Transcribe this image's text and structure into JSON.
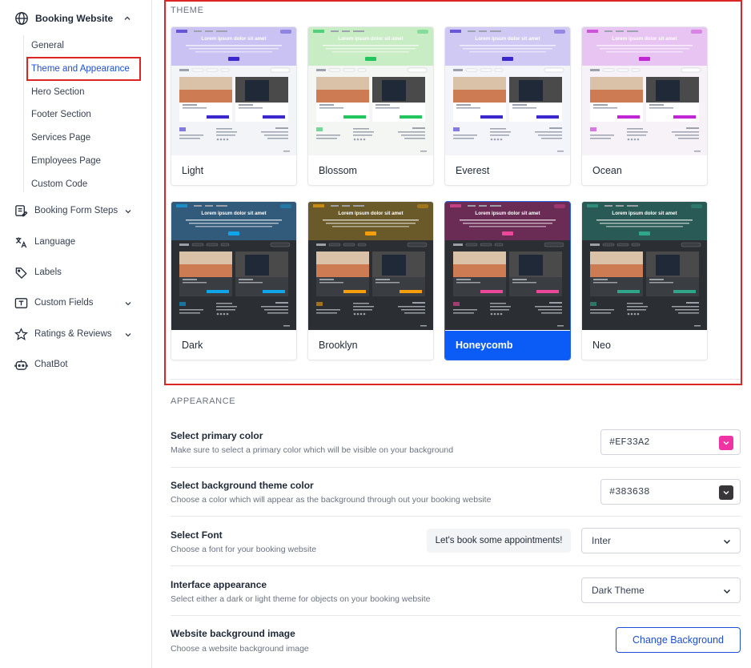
{
  "sidebar": {
    "top": {
      "label": "Booking Website",
      "icon": "globe-icon"
    },
    "subitems": [
      {
        "label": "General"
      },
      {
        "label": "Theme and Appearance",
        "active": true
      },
      {
        "label": "Hero Section"
      },
      {
        "label": "Footer Section"
      },
      {
        "label": "Services Page"
      },
      {
        "label": "Employees Page"
      },
      {
        "label": "Custom Code"
      }
    ],
    "items": [
      {
        "label": "Booking Form Steps",
        "icon": "form-steps-icon"
      },
      {
        "label": "Language",
        "icon": "translate-icon"
      },
      {
        "label": "Labels",
        "icon": "tag-icon"
      },
      {
        "label": "Custom Fields",
        "icon": "text-field-icon"
      },
      {
        "label": "Ratings & Reviews",
        "icon": "star-icon"
      },
      {
        "label": "ChatBot",
        "icon": "bot-icon"
      }
    ]
  },
  "theme": {
    "section_label": "THEME",
    "preview_headline": "Lorem ipsum dolor sit amet",
    "cards": [
      {
        "name": "Light",
        "accent": "#3b28cc",
        "bg": "#f3f4f8",
        "top": "#c9c2f2"
      },
      {
        "name": "Blossom",
        "accent": "#22c55e",
        "bg": "#f3f6f3",
        "top": "#c8ecc4"
      },
      {
        "name": "Everest",
        "accent": "#3b28cc",
        "bg": "#f4f4fb",
        "top": "#cfc9f3"
      },
      {
        "name": "Ocean",
        "accent": "#c026d3",
        "bg": "#f6f2f8",
        "top": "#e7c4f2"
      },
      {
        "name": "Dark",
        "accent": "#0ea5e9",
        "bg": "#2b2e33",
        "top": "#325a7a"
      },
      {
        "name": "Brooklyn",
        "accent": "#f59e0b",
        "bg": "#2b2e33",
        "top": "#6a5a2a"
      },
      {
        "name": "Honeycomb",
        "accent": "#ec4899",
        "bg": "#2b2e33",
        "top": "#6a2b55",
        "selected": true
      },
      {
        "name": "Neo",
        "accent": "#2fa58a",
        "bg": "#2b2e33",
        "top": "#2a5a55"
      }
    ]
  },
  "appearance": {
    "section_label": "APPEARANCE",
    "primary": {
      "title": "Select primary color",
      "subtitle": "Make sure to select a primary color which will be visible on your background",
      "value": "#EF33A2",
      "swatch_color": "#EF33A2"
    },
    "background": {
      "title": "Select background theme color",
      "subtitle": "Choose a color which will appear as the background through out your booking website",
      "value": "#383638",
      "swatch_color": "#383638"
    },
    "font": {
      "title": "Select Font",
      "subtitle": "Choose a font for your booking website",
      "preview": "Let's book some appointments!",
      "value": "Inter"
    },
    "interface": {
      "title": "Interface appearance",
      "subtitle": "Select either a dark or light theme for objects on your booking website",
      "value": "Dark Theme"
    },
    "bg_image": {
      "title": "Website background image",
      "subtitle": "Choose a website background image",
      "button": "Change Background"
    }
  }
}
